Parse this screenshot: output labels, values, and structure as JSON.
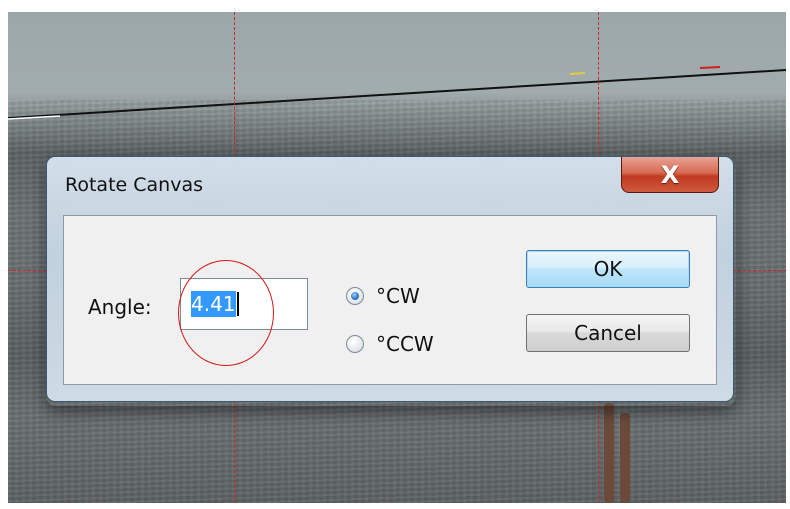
{
  "dialog": {
    "title": "Rotate Canvas",
    "close_label": "X",
    "angle_label": "Angle:",
    "angle_value": "4.41",
    "direction_options": [
      {
        "label": "°CW",
        "selected": true
      },
      {
        "label": "°CCW",
        "selected": false
      }
    ],
    "ok_label": "OK",
    "cancel_label": "Cancel"
  },
  "colors": {
    "guide_lines": "#d42020",
    "selection": "#3399ff",
    "close_button": "#c0391f",
    "annotation_circle": "#d11a1a"
  }
}
